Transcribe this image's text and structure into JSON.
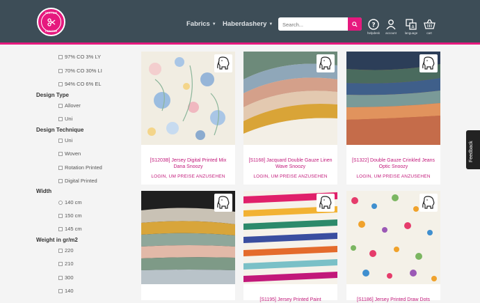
{
  "header": {
    "nav": [
      {
        "label": "Fabrics"
      },
      {
        "label": "Haberdashery"
      }
    ],
    "search_placeholder": "Search...",
    "icons": [
      {
        "name": "help-icon",
        "label": "helpdesk"
      },
      {
        "name": "account-icon",
        "label": "account"
      },
      {
        "name": "language-icon",
        "label": "language"
      },
      {
        "name": "cart-icon",
        "label": "cart"
      }
    ],
    "colors": {
      "bar": "#3d4d57",
      "accent": "#e6197e"
    }
  },
  "filters": {
    "composition": [
      "97% CO 3% LY",
      "70% CO 30% LI",
      "94% CO 6% EL"
    ],
    "design_type": {
      "title": "Design Type",
      "options": [
        "Allover",
        "Uni"
      ]
    },
    "design_technique": {
      "title": "Design Technique",
      "options": [
        "Uni",
        "Woven",
        "Rotation Printed",
        "Digital Printed"
      ]
    },
    "width": {
      "title": "Width",
      "options": [
        "140 cm",
        "150 cm",
        "145 cm"
      ]
    },
    "weight": {
      "title": "Weight in gr/m2",
      "options": [
        "220",
        "210",
        "300",
        "140"
      ]
    }
  },
  "products": [
    {
      "title": "[S1203B] Jersey Digital Printed Mix Dana Snoozy",
      "price": "LOGIN, UM PREISE ANZUSEHEN"
    },
    {
      "title": "[S1168] Jacquard Double Gauze Linen Wave Snoozy",
      "price": "LOGIN, UM PREISE ANZUSEHEN"
    },
    {
      "title": "[S1322] Double Gauze Crinkled Jeans Optic Snoozy",
      "price": "LOGIN, UM PREISE ANZUSEHEN"
    },
    {
      "title": "",
      "price": ""
    },
    {
      "title": "[S1195] Jersey Printed Paint",
      "price": ""
    },
    {
      "title": "[S1186] Jersey Printed Draw Dots",
      "price": ""
    }
  ],
  "feedback": "Feedback"
}
